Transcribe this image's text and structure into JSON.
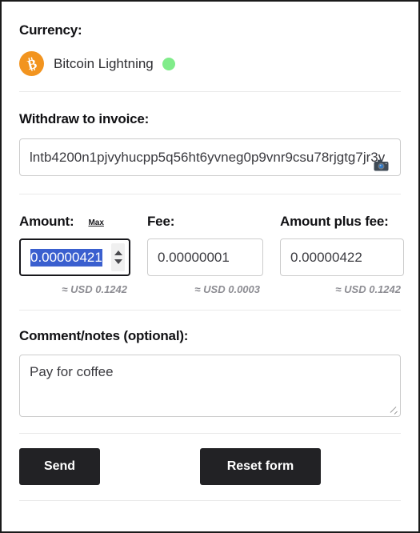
{
  "currency": {
    "label": "Currency:",
    "name": "Bitcoin Lightning",
    "logo_icon": "bitcoin-icon",
    "logo_color": "#f2941f",
    "status_icon": "status-dot-icon",
    "status_color": "#80ec8a"
  },
  "invoice": {
    "label": "Withdraw to invoice:",
    "value": "lntb4200n1pjvyhucpp5q56ht6yvneg0p9vnr9csu78rjgtg7jr3v",
    "scan_icon": "camera-icon"
  },
  "amount": {
    "label": "Amount:",
    "max_label": "Max",
    "value": "0.00000421",
    "usd_note": "≈ USD 0.1242",
    "spinner_up_icon": "spinner-up-icon",
    "spinner_down_icon": "spinner-down-icon",
    "selection_color": "#3a5fcf"
  },
  "fee": {
    "label": "Fee:",
    "value": "0.00000001",
    "usd_note": "≈ USD 0.0003"
  },
  "total": {
    "label": "Amount plus fee:",
    "value": "0.00000422",
    "usd_note": "≈ USD 0.1242"
  },
  "comment": {
    "label": "Comment/notes (optional):",
    "value": "Pay for coffee",
    "resize_icon": "resize-grip-icon"
  },
  "actions": {
    "send_label": "Send",
    "reset_label": "Reset form"
  }
}
